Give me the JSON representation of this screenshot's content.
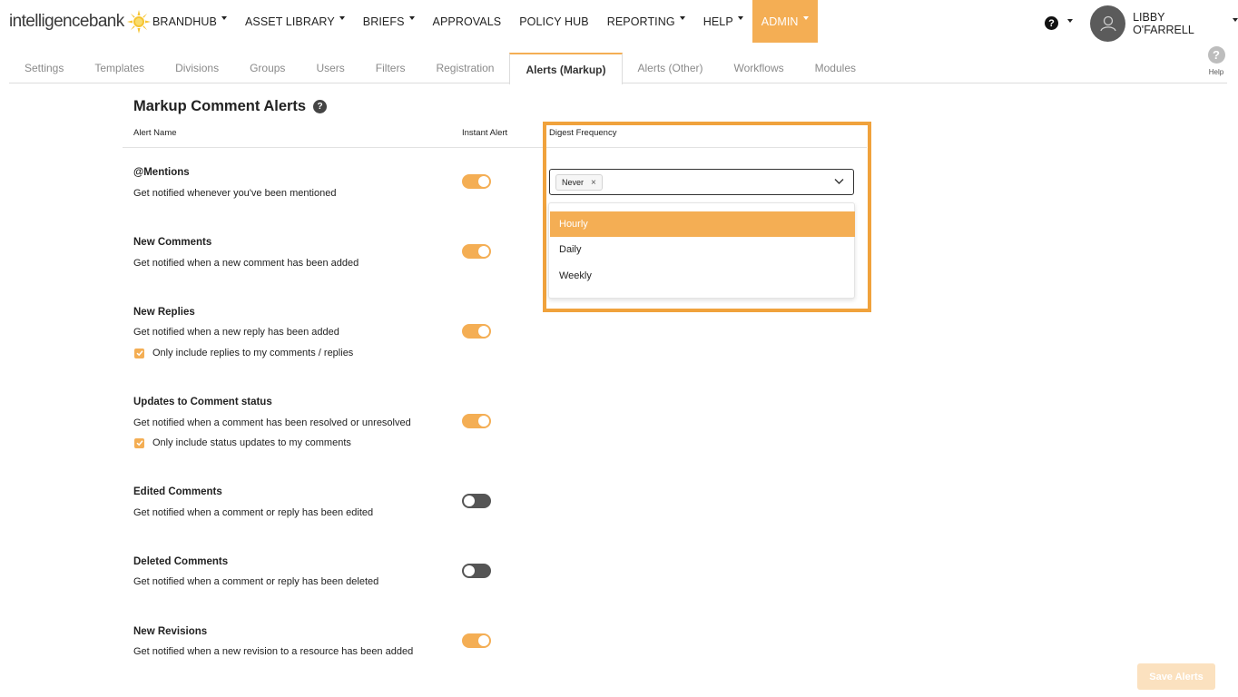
{
  "brand": {
    "logo_text": "intelligencebank",
    "accent": "#f4ae54"
  },
  "nav": {
    "items": [
      {
        "label": "BRANDHUB",
        "caret": true
      },
      {
        "label": "ASSET LIBRARY",
        "caret": true
      },
      {
        "label": "BRIEFS",
        "caret": true
      },
      {
        "label": "APPROVALS",
        "caret": false
      },
      {
        "label": "POLICY HUB",
        "caret": false
      },
      {
        "label": "REPORTING",
        "caret": true
      },
      {
        "label": "HELP",
        "caret": true
      },
      {
        "label": "ADMIN",
        "caret": true
      }
    ],
    "help_glyph": "?",
    "user_name": "LIBBY O'FARRELL"
  },
  "tabs": [
    "Settings",
    "Templates",
    "Divisions",
    "Groups",
    "Users",
    "Filters",
    "Registration",
    "Alerts (Markup)",
    "Alerts (Other)",
    "Workflows",
    "Modules"
  ],
  "help_side": {
    "glyph": "?",
    "label": "Help"
  },
  "page": {
    "title": "Markup Comment Alerts",
    "title_help": "?",
    "columns": {
      "alert_name": "Alert Name",
      "instant_alert": "Instant Alert",
      "digest_frequency": "Digest Frequency"
    }
  },
  "alerts": [
    {
      "name": "@Mentions",
      "desc": "Get notified whenever you've been mentioned",
      "instant": true
    },
    {
      "name": "New Comments",
      "desc": "Get notified when a new comment has been added",
      "instant": true
    },
    {
      "name": "New Replies",
      "desc": "Get notified when a new reply has been added",
      "instant": true,
      "checkbox": "Only include replies to my comments / replies"
    },
    {
      "name": "Updates to Comment status",
      "desc": "Get notified when a comment has been resolved or unresolved",
      "instant": true,
      "checkbox": "Only include status updates to my comments"
    },
    {
      "name": "Edited Comments",
      "desc": "Get notified when a comment or reply has been edited",
      "instant": false
    },
    {
      "name": "Deleted Comments",
      "desc": "Get notified when a comment or reply has been deleted",
      "instant": false
    },
    {
      "name": "New Revisions",
      "desc": "Get notified when a new revision to a resource has been added",
      "instant": true
    }
  ],
  "digest": {
    "selected_chip": "Never",
    "chip_remove": "×",
    "options": [
      "Hourly",
      "Daily",
      "Weekly"
    ],
    "highlighted_option": "Hourly"
  },
  "save_button": "Save Alerts"
}
